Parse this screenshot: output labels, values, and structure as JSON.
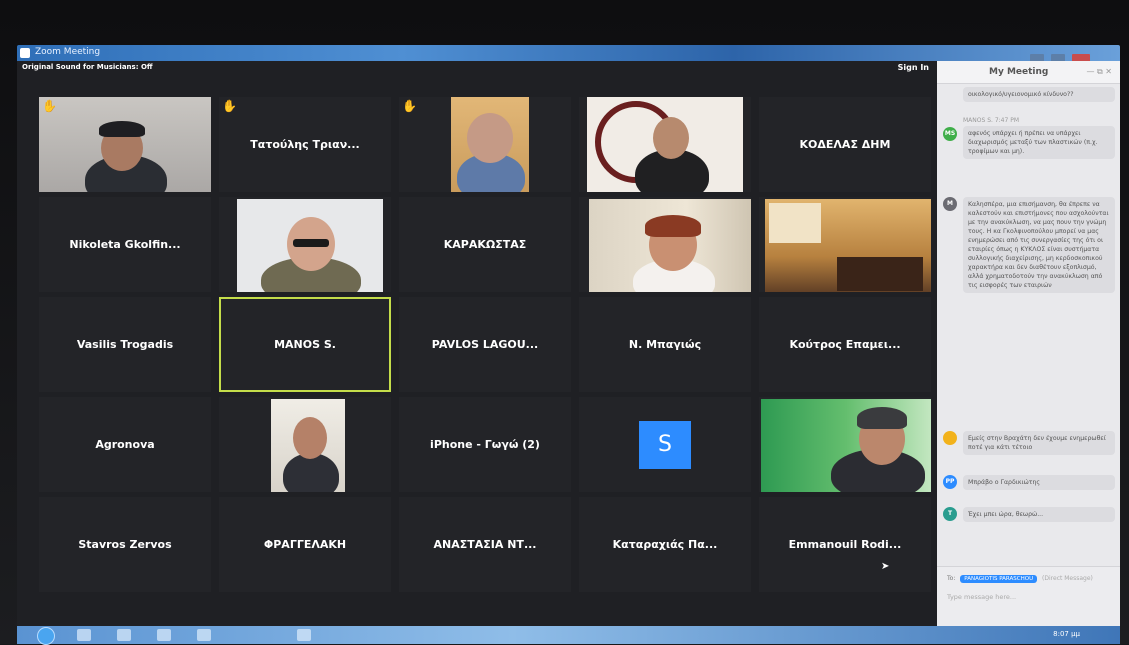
{
  "window": {
    "title": "Zoom Meeting"
  },
  "top_bar": {
    "original_sound": "Original Sound for Musicians: Off",
    "sign_in": "Sign In"
  },
  "tiles": {
    "t1": "",
    "t2": "Τατούλης Τριαν...",
    "t3": "",
    "t4": "",
    "t5": "ΚΟΔΕΛΑΣ ΔΗΜ",
    "t6": "Nikoleta Gkolfin...",
    "t7": "",
    "t8": "ΚΑΡΑΚΩΣΤΑΣ",
    "t9": "",
    "t10": "",
    "t11": "Vasilis Trogadis",
    "t12": "MANOS S.",
    "t13": "PAVLOS LAGOU...",
    "t14": "Ν. Μπαγιώς",
    "t15": "Κούτρος Επαμει...",
    "t16": "Agronova",
    "t17": "",
    "t18": "iPhone - Γωγώ (2)",
    "t19_avatar": "S",
    "t20": "",
    "t21": "Stavros Zervos",
    "t22": "ΦΡΑΓΓΕΛΑΚΗ",
    "t23": "ΑΝΑΣΤΑΣΙΑ ΝΤ...",
    "t24": "Καταραχιάς Πα...",
    "t25": "Emmanouil Rodi..."
  },
  "chat": {
    "title": "My Meeting",
    "messages": [
      {
        "sender": "",
        "avatar": "",
        "avatar_color": "#ffffff",
        "text": "οικολογικό/υγειονομικό κίνδυνο??"
      },
      {
        "sender": "MANOS S. 7:47 PM",
        "avatar": "MS",
        "avatar_color": "#3fae49",
        "text": "αφενός υπάρχει ή πρέπει να υπάρχει διαχωρισμός μεταξύ των πλαστικών (π.χ. τροφίμων και μη)."
      },
      {
        "sender": "",
        "avatar": "M",
        "avatar_color": "#6b6b72",
        "text": "Καλησπέρα, μια επισήμανση, θα έπρεπε να καλεστούν και επιστήμονες που ασχολούνται με την ανακύκλωση, να μας πουν την γνώμη τους. Η κα Γκολφινοπούλου μπορεί να μας ενημερώσει από τις συνεργασίες της ότι οι εταιρίες όπως η ΚΥΚΛΟΣ είναι συστήματα συλλογικής διαχείρισης, μη κερδοσκοπικού χαρακτήρα και δεν διαθέτουν εξοπλισμό, αλλά χρηματοδοτούν την ανακύκλωση από τις εισφορές των εταιριών"
      },
      {
        "sender": "",
        "avatar": "",
        "avatar_color": "#f2b21b",
        "text": "Εμείς στην Βραχάτη δεν έχουμε ενημερωθεί ποτέ για κάτι τέτοιο"
      },
      {
        "sender": "",
        "avatar": "PP",
        "avatar_color": "#2d8cff",
        "text": "Μπράβο ο Γαρδικιώτης"
      },
      {
        "sender": "",
        "avatar": "T",
        "avatar_color": "#2a9d8f",
        "text": "Έχει μπει ώρα, θεωρώ..."
      }
    ],
    "to_label": "To:",
    "to_recipient": "PANAGIOTIS PARASCHOU",
    "direct_message_hint": "(Direct Message)",
    "input_placeholder": "Type message here..."
  },
  "taskbar": {
    "clock": "8:07 μμ"
  }
}
